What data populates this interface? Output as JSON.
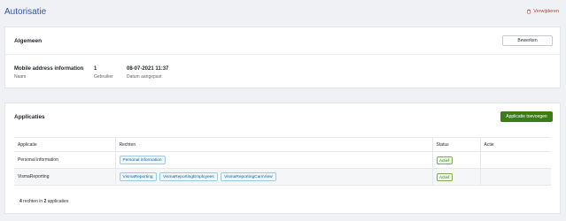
{
  "page": {
    "title": "Autorisatie"
  },
  "actions": {
    "delete_label": "Verwijderen"
  },
  "general": {
    "title": "Algemeen",
    "edit_label": "Bewerken",
    "fields": [
      {
        "value": "Mobile address information",
        "label": "Naam"
      },
      {
        "value": "1",
        "label": "Gebruiker"
      },
      {
        "value": "08-07-2021 11:37",
        "label": "Datum aangepast"
      }
    ]
  },
  "applications": {
    "title": "Applicaties",
    "add_label": "Applicatie toevoegen",
    "columns": [
      "Applicatie",
      "Rechten",
      "Status",
      "Actie"
    ],
    "rows": [
      {
        "name": "Personal information",
        "rights": [
          "Personal information"
        ],
        "status": "Actief"
      },
      {
        "name": "VismaReporting",
        "rights": [
          "VismaReporting",
          "VismaReportingEmployees",
          "VismaReportingCamView"
        ],
        "status": "Actief"
      }
    ],
    "summary": {
      "rights_count": "4",
      "middle": "rechten in",
      "apps_count": "2",
      "end": "applicaties"
    }
  },
  "colors": {
    "accent": "#2e57a6",
    "danger": "#d8322b",
    "success": "#3d7d17"
  }
}
